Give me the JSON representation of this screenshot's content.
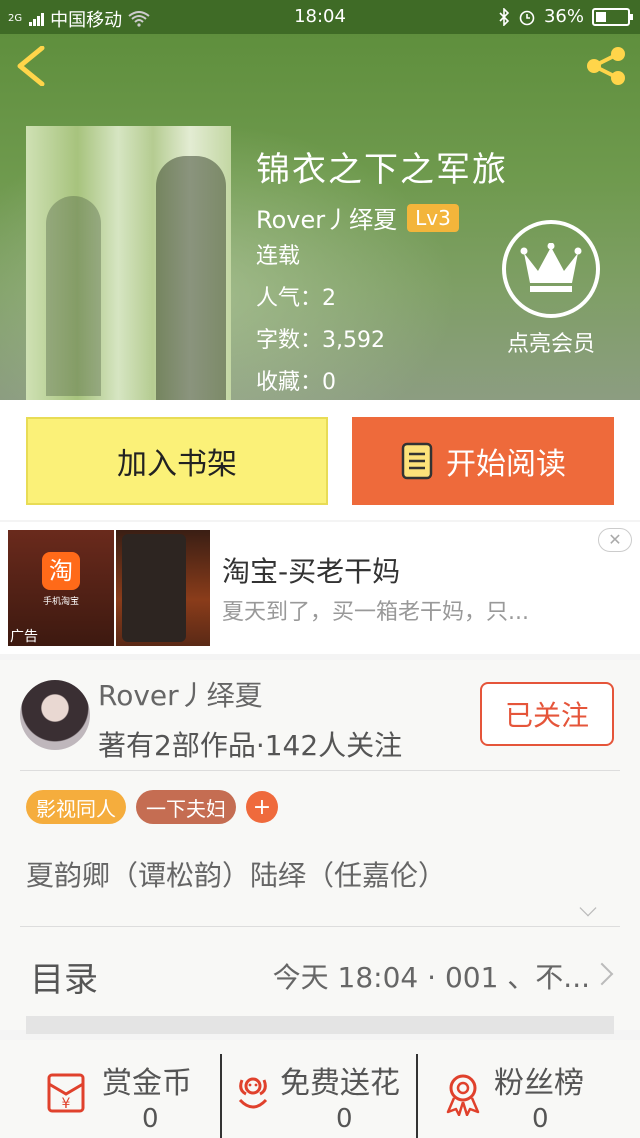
{
  "status_bar": {
    "signal": "2G",
    "carrier": "中国移动",
    "time": "18:04",
    "battery": "36%"
  },
  "book": {
    "title": "锦衣之下之军旅",
    "author": "Rover丿绎夏",
    "level": "Lv3",
    "status": "连载",
    "popularity": "人气：2",
    "word_count": "字数：3,592",
    "favorites": "收藏：0"
  },
  "vip": {
    "label": "点亮会员"
  },
  "actions": {
    "add_shelf": "加入书架",
    "start_read": "开始阅读"
  },
  "ad": {
    "title": "淘宝-买老干妈",
    "desc": "夏天到了，买一箱老干妈，只...",
    "tag": "广告",
    "img_brand": "淘",
    "img_app": "手机淘宝"
  },
  "author_card": {
    "name": "Rover丿绎夏",
    "stats": "著有2部作品·142人关注",
    "follow_label": "已关注"
  },
  "tags": [
    "影视同人",
    "一下夫妇"
  ],
  "tag_add": "+",
  "description": "夏韵卿（谭松韵）陆绎（任嘉伦）",
  "toc": {
    "label": "目录",
    "latest": "今天 18:04 · 001 、不..."
  },
  "bottom_stats": [
    {
      "label": "赏金币",
      "value": "0"
    },
    {
      "label": "免费送花",
      "value": "0"
    },
    {
      "label": "粉丝榜",
      "value": "0"
    }
  ],
  "colors": {
    "accent": "#ee6a3b",
    "shelf": "#fbf178",
    "level": "#f3b53b"
  }
}
